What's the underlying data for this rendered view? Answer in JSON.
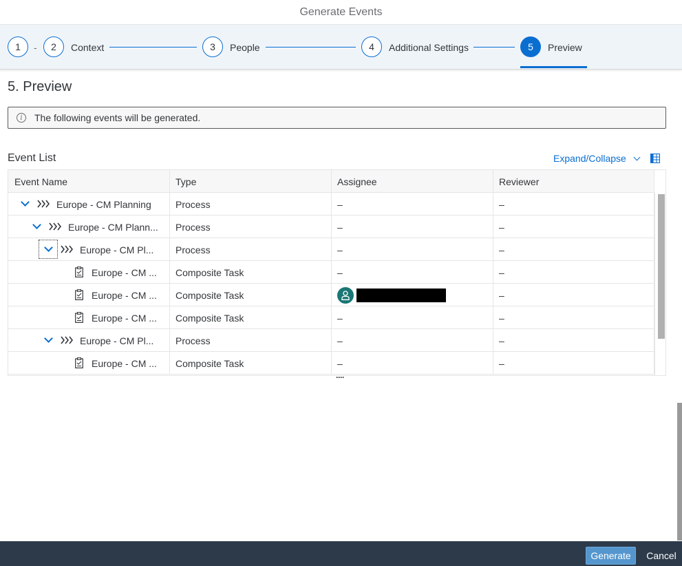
{
  "dialog": {
    "title": "Generate Events"
  },
  "wizard": {
    "steps": [
      {
        "number": "1",
        "label": ""
      },
      {
        "number": "2",
        "label": "Context"
      },
      {
        "number": "3",
        "label": "People"
      },
      {
        "number": "4",
        "label": "Additional Settings"
      },
      {
        "number": "5",
        "label": "Preview"
      }
    ],
    "separator": "-",
    "active_step": 5,
    "accent": "#0a6ed1"
  },
  "page": {
    "title": "5. Preview",
    "info_message": "The following events will be generated."
  },
  "event_list": {
    "title": "Event List",
    "expand_collapse_label": "Expand/Collapse",
    "columns": [
      "Event Name",
      "Type",
      "Assignee",
      "Reviewer"
    ],
    "rows": [
      {
        "name": "Europe - CM Planning",
        "type": "Process",
        "assignee": "–",
        "reviewer": "–",
        "icon": "process-icon",
        "expandable": true
      },
      {
        "name": "Europe - CM Plann...",
        "type": "Process",
        "assignee": "–",
        "reviewer": "–",
        "icon": "process-icon",
        "expandable": true
      },
      {
        "name": "Europe - CM Pl...",
        "type": "Process",
        "assignee": "–",
        "reviewer": "–",
        "icon": "process-icon",
        "expandable": true
      },
      {
        "name": "Europe - CM ...",
        "type": "Composite Task",
        "assignee": "–",
        "reviewer": "–",
        "icon": "task-icon",
        "expandable": false
      },
      {
        "name": "Europe - CM ...",
        "type": "Composite Task",
        "assignee": "",
        "reviewer": "–",
        "icon": "task-icon",
        "expandable": false
      },
      {
        "name": "Europe - CM ...",
        "type": "Composite Task",
        "assignee": "–",
        "reviewer": "–",
        "icon": "task-icon",
        "expandable": false
      },
      {
        "name": "Europe - CM Pl...",
        "type": "Process",
        "assignee": "–",
        "reviewer": "–",
        "icon": "process-icon",
        "expandable": true
      },
      {
        "name": "Europe - CM ...",
        "type": "Composite Task",
        "assignee": "–",
        "reviewer": "–",
        "icon": "task-icon",
        "expandable": false
      }
    ],
    "more_indicator": "····"
  },
  "footer": {
    "generate_label": "Generate",
    "cancel_label": "Cancel"
  }
}
